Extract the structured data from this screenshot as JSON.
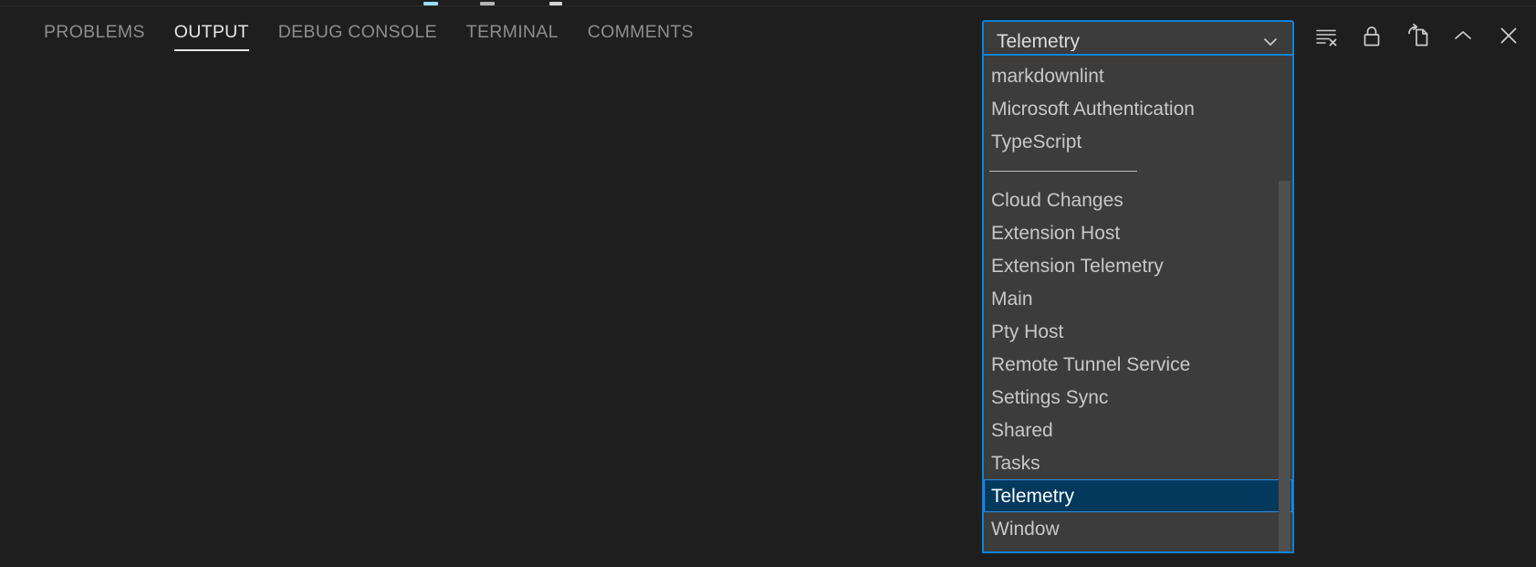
{
  "panel": {
    "background_color": "#1e1e1e",
    "tabs": [
      {
        "label": "PROBLEMS",
        "active": false
      },
      {
        "label": "OUTPUT",
        "active": true
      },
      {
        "label": "DEBUG CONSOLE",
        "active": false
      },
      {
        "label": "TERMINAL",
        "active": false
      },
      {
        "label": "COMMENTS",
        "active": false
      }
    ],
    "output_body_text": ""
  },
  "toolbar": {
    "items": [
      {
        "name": "clear-output-icon",
        "title": "Clear Output"
      },
      {
        "name": "lock-icon",
        "title": "Turn Auto Scrolling Off"
      },
      {
        "name": "open-in-editor-icon",
        "title": "Open Output in Editor"
      },
      {
        "name": "chevron-up-icon",
        "title": "Hide Panel"
      },
      {
        "name": "close-icon",
        "title": "Close Panel"
      }
    ]
  },
  "output_select": {
    "name": "output-channel-select",
    "selected": "Telemetry",
    "chevron_icon": "chevron-down-icon",
    "expanded": true,
    "accent_color": "#0a84d8",
    "background_color": "#3c3c3c"
  },
  "dropdown": {
    "selected_value": "Telemetry",
    "selected_background": "#04395e",
    "groups": [
      {
        "id": "extensions",
        "items": [
          "markdownlint",
          "Microsoft Authentication",
          "TypeScript"
        ]
      },
      {
        "id": "core",
        "items": [
          "Cloud Changes",
          "Extension Host",
          "Extension Telemetry",
          "Main",
          "Pty Host",
          "Remote Tunnel Service",
          "Settings Sync",
          "Shared",
          "Tasks",
          "Telemetry",
          "Window"
        ]
      }
    ],
    "scrollbar": {
      "name": "dropdown-scrollbar",
      "thumb_color": "#4f4f4f"
    }
  }
}
